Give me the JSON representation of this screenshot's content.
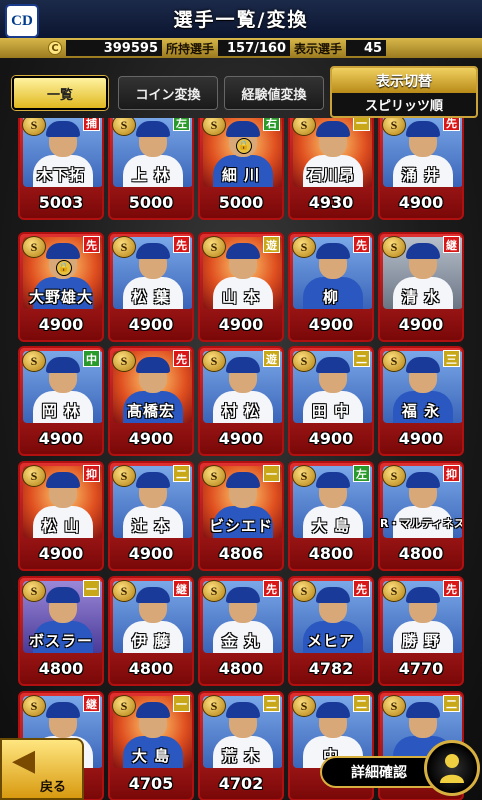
{
  "header": {
    "logo_text": "CD",
    "title": "選手一覧/変換"
  },
  "status": {
    "coin_icon": "coin-icon",
    "coin_value": "399595",
    "owned_label": "所持選手",
    "owned_value": "157/160",
    "shown_label": "表示選手",
    "shown_value": "45"
  },
  "tabs": [
    {
      "label": "一覧",
      "active": true
    },
    {
      "label": "コイン変換",
      "active": false
    },
    {
      "label": "経験値変換",
      "active": false
    }
  ],
  "display_switch": {
    "label": "表示切替",
    "value": "スピリッツ順"
  },
  "players": [
    {
      "name": "木下拓",
      "value": "5003",
      "pos": "捕",
      "pos_color": "red"
    },
    {
      "name": "上 林",
      "value": "5000",
      "pos": "左",
      "pos_color": "green"
    },
    {
      "name": "細 川",
      "value": "5000",
      "pos": "右",
      "pos_color": "green"
    },
    {
      "name": "石川昂",
      "value": "4930",
      "pos": "一",
      "pos_color": "yellow"
    },
    {
      "name": "涌 井",
      "value": "4900",
      "pos": "先",
      "pos_color": "red"
    },
    {
      "name": "大野雄大",
      "value": "4900",
      "pos": "先",
      "pos_color": "red"
    },
    {
      "name": "松 葉",
      "value": "4900",
      "pos": "先",
      "pos_color": "red"
    },
    {
      "name": "山 本",
      "value": "4900",
      "pos": "遊",
      "pos_color": "yellow"
    },
    {
      "name": "柳",
      "value": "4900",
      "pos": "先",
      "pos_color": "red"
    },
    {
      "name": "清 水",
      "value": "4900",
      "pos": "継",
      "pos_color": "red"
    },
    {
      "name": "岡 林",
      "value": "4900",
      "pos": "中",
      "pos_color": "green"
    },
    {
      "name": "髙橋宏",
      "value": "4900",
      "pos": "先",
      "pos_color": "red"
    },
    {
      "name": "村 松",
      "value": "4900",
      "pos": "遊",
      "pos_color": "yellow"
    },
    {
      "name": "田 中",
      "value": "4900",
      "pos": "二",
      "pos_color": "yellow"
    },
    {
      "name": "福 永",
      "value": "4900",
      "pos": "三",
      "pos_color": "yellow"
    },
    {
      "name": "松 山",
      "value": "4900",
      "pos": "抑",
      "pos_color": "red"
    },
    {
      "name": "辻 本",
      "value": "4900",
      "pos": "二",
      "pos_color": "yellow"
    },
    {
      "name": "ビシエド",
      "value": "4806",
      "pos": "一",
      "pos_color": "yellow"
    },
    {
      "name": "大 島",
      "value": "4800",
      "pos": "左",
      "pos_color": "green"
    },
    {
      "name": "R・マルティネス",
      "value": "4800",
      "pos": "抑",
      "pos_color": "red"
    },
    {
      "name": "ボスラー",
      "value": "4800",
      "pos": "一",
      "pos_color": "yellow"
    },
    {
      "name": "伊 藤",
      "value": "4800",
      "pos": "継",
      "pos_color": "red"
    },
    {
      "name": "金 丸",
      "value": "4800",
      "pos": "先",
      "pos_color": "red"
    },
    {
      "name": "メヒア",
      "value": "4782",
      "pos": "先",
      "pos_color": "red"
    },
    {
      "name": "勝 野",
      "value": "4770",
      "pos": "先",
      "pos_color": "red"
    },
    {
      "name": "",
      "value": "",
      "pos": "継",
      "pos_color": "red"
    },
    {
      "name": "大 島",
      "value": "4705",
      "pos": "一",
      "pos_color": "yellow"
    },
    {
      "name": "荒 木",
      "value": "4702",
      "pos": "二",
      "pos_color": "yellow"
    },
    {
      "name": "中",
      "value": "",
      "pos": "二",
      "pos_color": "yellow"
    },
    {
      "name": "",
      "value": "",
      "pos": "二",
      "pos_color": "yellow"
    }
  ],
  "footer": {
    "back_label": "戻る",
    "detail_label": "詳細確認",
    "person_icon": "person-icon"
  },
  "colors": {
    "gold": "#d8b040",
    "red_frame": "#b01010",
    "position_red": "#d81818",
    "position_green": "#2a9a2a",
    "position_yellow": "#c8a818"
  }
}
